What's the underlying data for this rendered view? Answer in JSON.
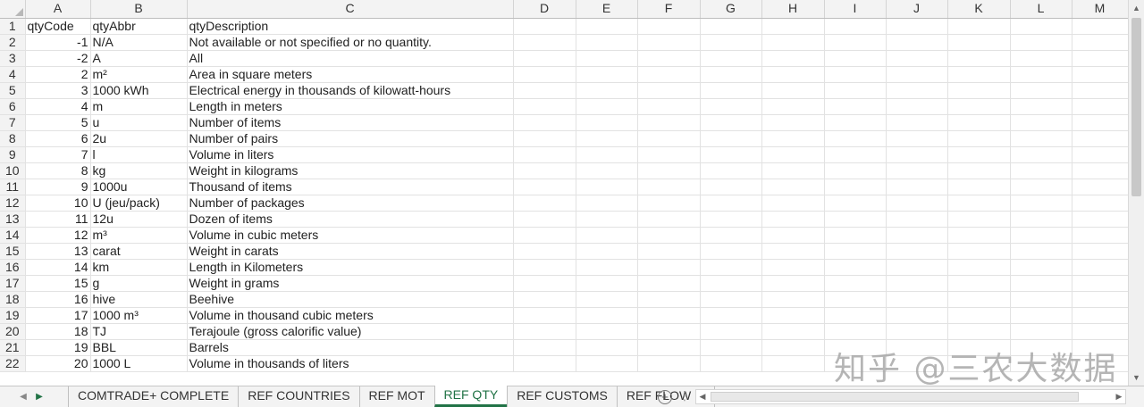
{
  "columns": [
    "A",
    "B",
    "C",
    "D",
    "E",
    "F",
    "G",
    "H",
    "I",
    "J",
    "K",
    "L",
    "M"
  ],
  "rows": [
    {
      "n": "1",
      "a": "qtyCode",
      "b": "qtyAbbr",
      "c": "qtyDescription",
      "header": true
    },
    {
      "n": "2",
      "a": "-1",
      "b": "N/A",
      "c": "Not available or not specified or no quantity."
    },
    {
      "n": "3",
      "a": "-2",
      "b": "A",
      "c": "All"
    },
    {
      "n": "4",
      "a": "2",
      "b": "m²",
      "c": "Area in square meters"
    },
    {
      "n": "5",
      "a": "3",
      "b": "1000 kWh",
      "c": "Electrical energy in thousands of kilowatt-hours"
    },
    {
      "n": "6",
      "a": "4",
      "b": "m",
      "c": "Length in meters"
    },
    {
      "n": "7",
      "a": "5",
      "b": "u",
      "c": "Number of items"
    },
    {
      "n": "8",
      "a": "6",
      "b": "2u",
      "c": "Number of pairs"
    },
    {
      "n": "9",
      "a": "7",
      "b": "l",
      "c": "Volume in liters"
    },
    {
      "n": "10",
      "a": "8",
      "b": "kg",
      "c": "Weight in kilograms"
    },
    {
      "n": "11",
      "a": "9",
      "b": "1000u",
      "c": "Thousand of items"
    },
    {
      "n": "12",
      "a": "10",
      "b": "U (jeu/pack)",
      "c": "Number of packages"
    },
    {
      "n": "13",
      "a": "11",
      "b": "12u",
      "c": "Dozen of items"
    },
    {
      "n": "14",
      "a": "12",
      "b": "m³",
      "c": "Volume in cubic meters"
    },
    {
      "n": "15",
      "a": "13",
      "b": "carat",
      "c": "Weight in carats"
    },
    {
      "n": "16",
      "a": "14",
      "b": "km",
      "c": "Length in Kilometers"
    },
    {
      "n": "17",
      "a": "15",
      "b": "g",
      "c": "Weight in grams"
    },
    {
      "n": "18",
      "a": "16",
      "b": "hive",
      "c": "Beehive"
    },
    {
      "n": "19",
      "a": "17",
      "b": "1000 m³",
      "c": "Volume in thousand cubic meters"
    },
    {
      "n": "20",
      "a": "18",
      "b": "TJ",
      "c": "Terajoule (gross calorific value)"
    },
    {
      "n": "21",
      "a": "19",
      "b": "BBL",
      "c": "Barrels"
    },
    {
      "n": "22",
      "a": "20",
      "b": "1000 L",
      "c": "Volume in thousands of liters"
    }
  ],
  "sheet_tabs": [
    "COMTRADE+ COMPLETE",
    "REF COUNTRIES",
    "REF MOT",
    "REF QTY",
    "REF CUSTOMS",
    "REF FLOW ..."
  ],
  "active_tab": "REF QTY",
  "icons": {
    "prev": "triangle-left-icon",
    "next": "triangle-right-icon",
    "add": "plus-circle-icon",
    "more": "vertical-ellipsis-icon"
  },
  "glyphs": {
    "prev": "◀",
    "next": "▶",
    "add": "+",
    "more": "⋮",
    "up": "▲",
    "down": "▼",
    "left": "◀",
    "right": "▶"
  },
  "watermark": "知乎 @三农大数据",
  "colors": {
    "accent": "#217346",
    "header_bg": "#f3f3f3",
    "grid_line": "#e2e2e2"
  }
}
